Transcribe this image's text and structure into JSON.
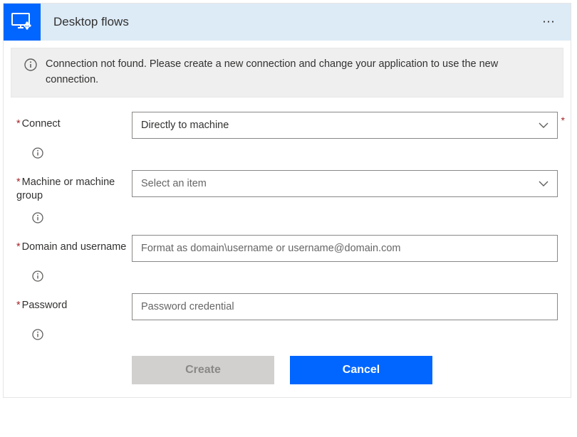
{
  "header": {
    "title": "Desktop flows"
  },
  "warning": {
    "text": "Connection not found. Please create a new connection and change your application to use the new connection."
  },
  "form": {
    "connect": {
      "label": "Connect",
      "value": "Directly to machine"
    },
    "machine": {
      "label": "Machine or machine group",
      "placeholder": "Select an item"
    },
    "domain": {
      "label": "Domain and username",
      "placeholder": "Format as domain\\username or username@domain.com"
    },
    "password": {
      "label": "Password",
      "placeholder": "Password credential"
    }
  },
  "buttons": {
    "create": "Create",
    "cancel": "Cancel"
  }
}
